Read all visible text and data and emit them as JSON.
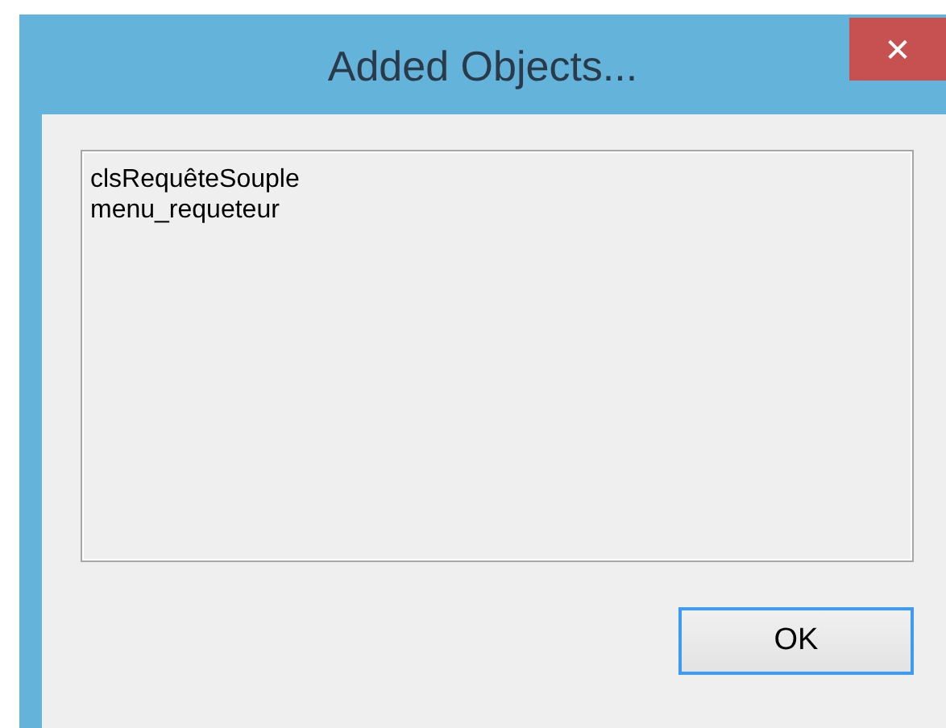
{
  "window": {
    "title": "Added Objects...",
    "close": "✕"
  },
  "list": {
    "items": [
      "clsRequêteSouple",
      "menu_requeteur"
    ]
  },
  "buttons": [
    {
      "label": "OK",
      "focused": true
    }
  ]
}
